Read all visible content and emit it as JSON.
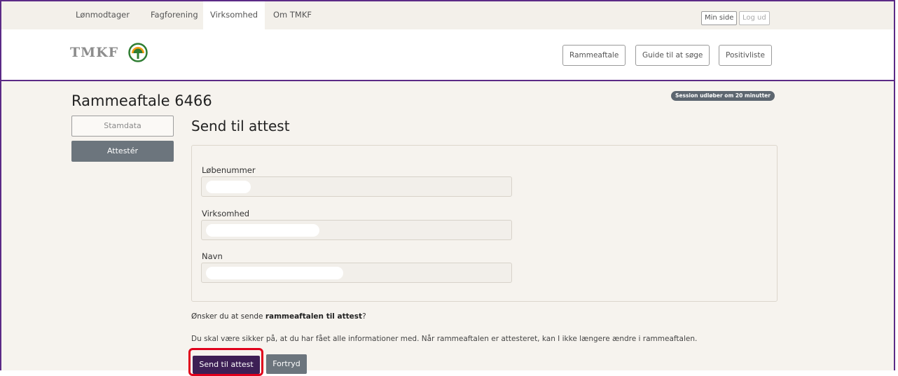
{
  "topnav": {
    "items": [
      {
        "label": "Lønmodtager"
      },
      {
        "label": "Fagforening"
      },
      {
        "label": "Virksomhed",
        "active": true
      },
      {
        "label": "Om TMKF"
      }
    ],
    "min_side_label": "Min side",
    "log_ud_label": "Log ud"
  },
  "header": {
    "logo_text": "TMKF",
    "buttons": [
      {
        "label": "Rammeaftale"
      },
      {
        "label": "Guide til at søge"
      },
      {
        "label": "Positivliste"
      }
    ]
  },
  "page": {
    "title": "Rammeaftale 6466",
    "session_badge": "Session udløber om 20 minutter",
    "sidebar": [
      {
        "label": "Stamdata"
      },
      {
        "label": "Attestér"
      }
    ],
    "section_title": "Send til attest",
    "fields": [
      {
        "label": "Løbenummer",
        "value": ""
      },
      {
        "label": "Virksomhed",
        "value": ""
      },
      {
        "label": "Navn",
        "value": ""
      }
    ],
    "question_prefix": "Ønsker du at sende ",
    "question_bold": "rammeaftalen til attest",
    "question_suffix": "?",
    "info_text": "Du skal være sikker på, at du har fået alle informationer med. Når rammeaftalen er attesteret, kan I ikke længere ændre i rammeaftalen.",
    "send_button": "Send til attest",
    "cancel_button": "Fortryd"
  },
  "colors": {
    "brand_purple": "#5b2a86",
    "primary_button": "#3d1f55",
    "secondary_button": "#6c757d",
    "highlight": "#e0001b",
    "logo_green": "#2e7d32",
    "logo_orange": "#f39c12"
  },
  "icons": {
    "logo": "tree-logo-icon"
  }
}
